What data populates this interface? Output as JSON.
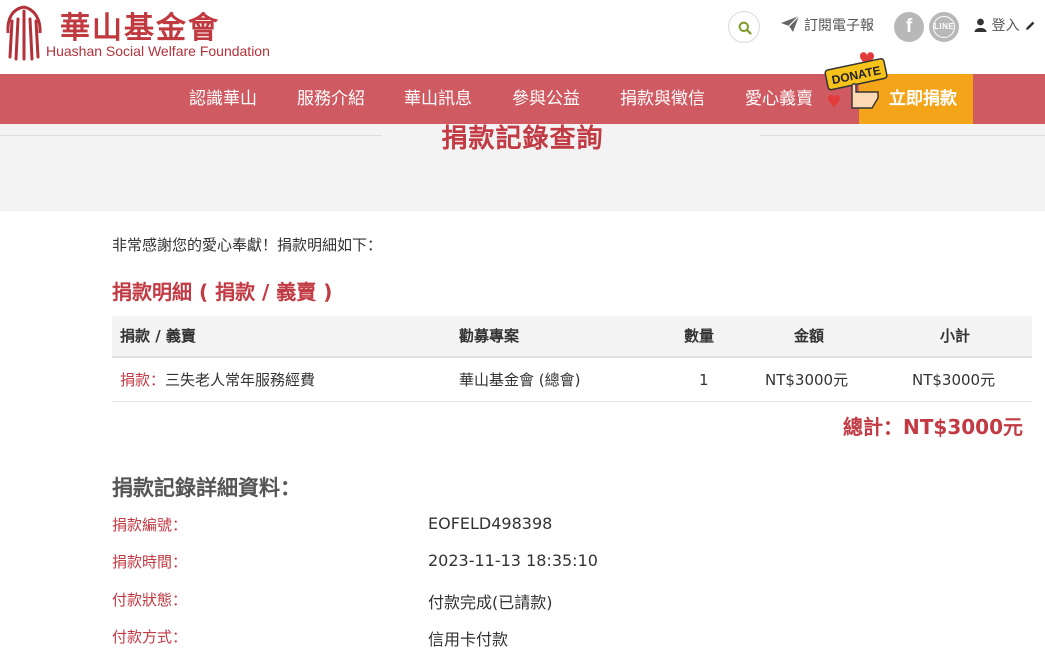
{
  "header": {
    "logo_title": "華山基金會",
    "logo_subtitle": "Huashan Social Welfare Foundation",
    "subscribe_label": "訂閱電子報",
    "facebook_glyph": "f",
    "line_glyph": "LINE",
    "login_label": "登入"
  },
  "nav": {
    "items": [
      {
        "label": "認識華山"
      },
      {
        "label": "服務介紹"
      },
      {
        "label": "華山訊息"
      },
      {
        "label": "參與公益"
      },
      {
        "label": "捐款與徵信"
      },
      {
        "label": "愛心義賣"
      }
    ],
    "donate_badge": "DONATE",
    "donate_now": "立即捐款"
  },
  "page": {
    "title": "捐款記錄查詢",
    "thanks": "非常感謝您的愛心奉獻！捐款明細如下：",
    "section_title": "捐款明細 ( 捐款 / 義賣 )"
  },
  "table": {
    "headers": [
      "捐款 / 義賣",
      "勸募專案",
      "數量",
      "金額",
      "小計"
    ],
    "rows": [
      {
        "type": "捐款：",
        "item": "三失老人常年服務經費",
        "project": "華山基金會 (總會)",
        "qty": "1",
        "amount": "NT$3000元",
        "subtotal": "NT$3000元"
      }
    ],
    "total": "總計：NT$3000元"
  },
  "details": {
    "title": "捐款記錄詳細資料：",
    "fields": [
      {
        "label": "捐款編號：",
        "value": "EOFELD498398"
      },
      {
        "label": "捐款時間：",
        "value": "2023-11-13 18:35:10"
      },
      {
        "label": "付款狀態：",
        "value": "付款完成(已請款)"
      },
      {
        "label": "付款方式：",
        "value": "信用卡付款"
      }
    ]
  },
  "colors": {
    "brand_red": "#c23a43",
    "nav_bg": "#d05a62",
    "donate_orange": "#f3a419"
  },
  "icons": [
    "logo-mark-icon",
    "search-icon",
    "paper-plane-icon",
    "facebook-icon",
    "line-icon",
    "user-icon",
    "pencil-icon",
    "donate-hand-icon"
  ]
}
